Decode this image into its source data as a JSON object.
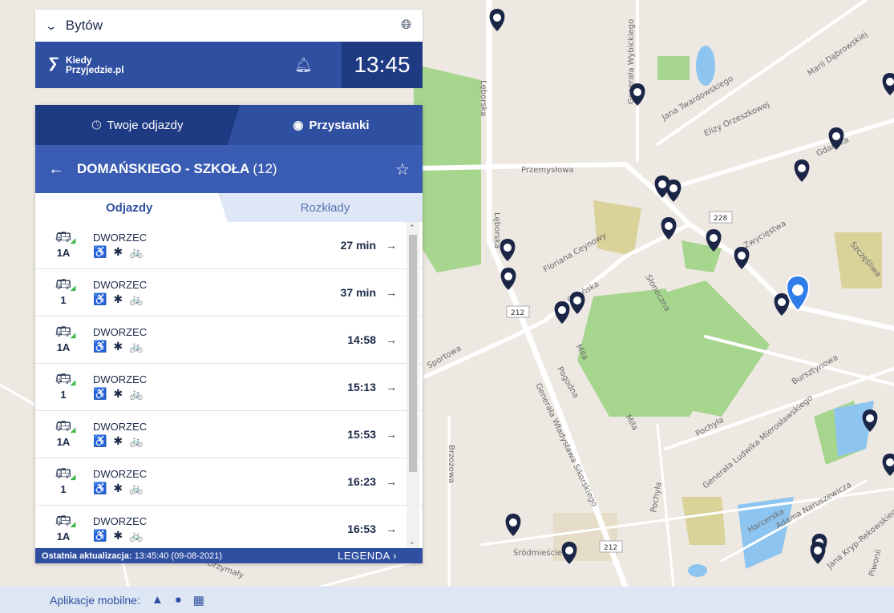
{
  "header": {
    "city": "Bytów",
    "logo_line1": "Kiedy",
    "logo_line2": "Przyjedzie.pl",
    "clock": "13:45"
  },
  "tabs": [
    {
      "label": "Twoje odjazdy",
      "icon": "clock-icon",
      "active": false
    },
    {
      "label": "Przystanki",
      "icon": "stops-pin-icon",
      "active": true
    }
  ],
  "stop": {
    "name": "DOMAŃSKIEGO - SZKOŁA",
    "count": "(12)"
  },
  "subtabs": [
    {
      "label": "Odjazdy",
      "active": true
    },
    {
      "label": "Rozkłady",
      "active": false
    }
  ],
  "departures": [
    {
      "line": "1A",
      "dest": "DWORZEC",
      "features": "♿ ✱ 🚲",
      "time": "27 min"
    },
    {
      "line": "1",
      "dest": "DWORZEC",
      "features": "♿ ✱ 🚲",
      "time": "37 min"
    },
    {
      "line": "1A",
      "dest": "DWORZEC",
      "features": "♿ ✱ 🚲",
      "time": "14:58"
    },
    {
      "line": "1",
      "dest": "DWORZEC",
      "features": "♿ ✱ 🚲",
      "time": "15:13"
    },
    {
      "line": "1A",
      "dest": "DWORZEC",
      "features": "♿ ✱ 🚲",
      "time": "15:53"
    },
    {
      "line": "1",
      "dest": "DWORZEC",
      "features": "♿ ✱ 🚲",
      "time": "16:23"
    },
    {
      "line": "1A",
      "dest": "DWORZEC",
      "features": "♿ ✱ 🚲",
      "time": "16:53"
    }
  ],
  "footer": {
    "update_label": "Ostatnia aktualizacja:",
    "update_value": "13:45:40 (09-08-2021)",
    "legend": "LEGENDA"
  },
  "bottom": {
    "label": "Aplikacje mobilne:",
    "apps": [
      "android-icon",
      "apple-icon",
      "windows-icon"
    ]
  },
  "map": {
    "labels": [
      "Przemysłowa",
      "Lęborska",
      "Lęborska",
      "Floriana Ceynowy",
      "Gdańska",
      "Gdańska",
      "Słoneczna",
      "Sportowa",
      "Pogodna",
      "Miła",
      "Miła",
      "Generała Władysława Sikorskiego",
      "Brzozowa",
      "Pochyła",
      "Pochyła",
      "Bursztynowa",
      "Zwycięstwa",
      "Szczęśliwa",
      "Generała Ludwika Mierosławskiego",
      "Harcerska",
      "Adama Naruszewicza",
      "Śródmieście",
      "Jana Twardowskiego",
      "Elizy Orzeszkowej",
      "Marii Dąbrowskiej",
      "Generała Wybickiego",
      "Drzymały",
      "Piwonii",
      "Jana Kryp-Rekowskiego"
    ],
    "road_numbers": [
      "228",
      "212",
      "212"
    ],
    "colors": {
      "marker": "#1b2546",
      "selected_marker": "#2f7de8",
      "park": "#a6d58e",
      "water": "#8ec5f0"
    }
  }
}
